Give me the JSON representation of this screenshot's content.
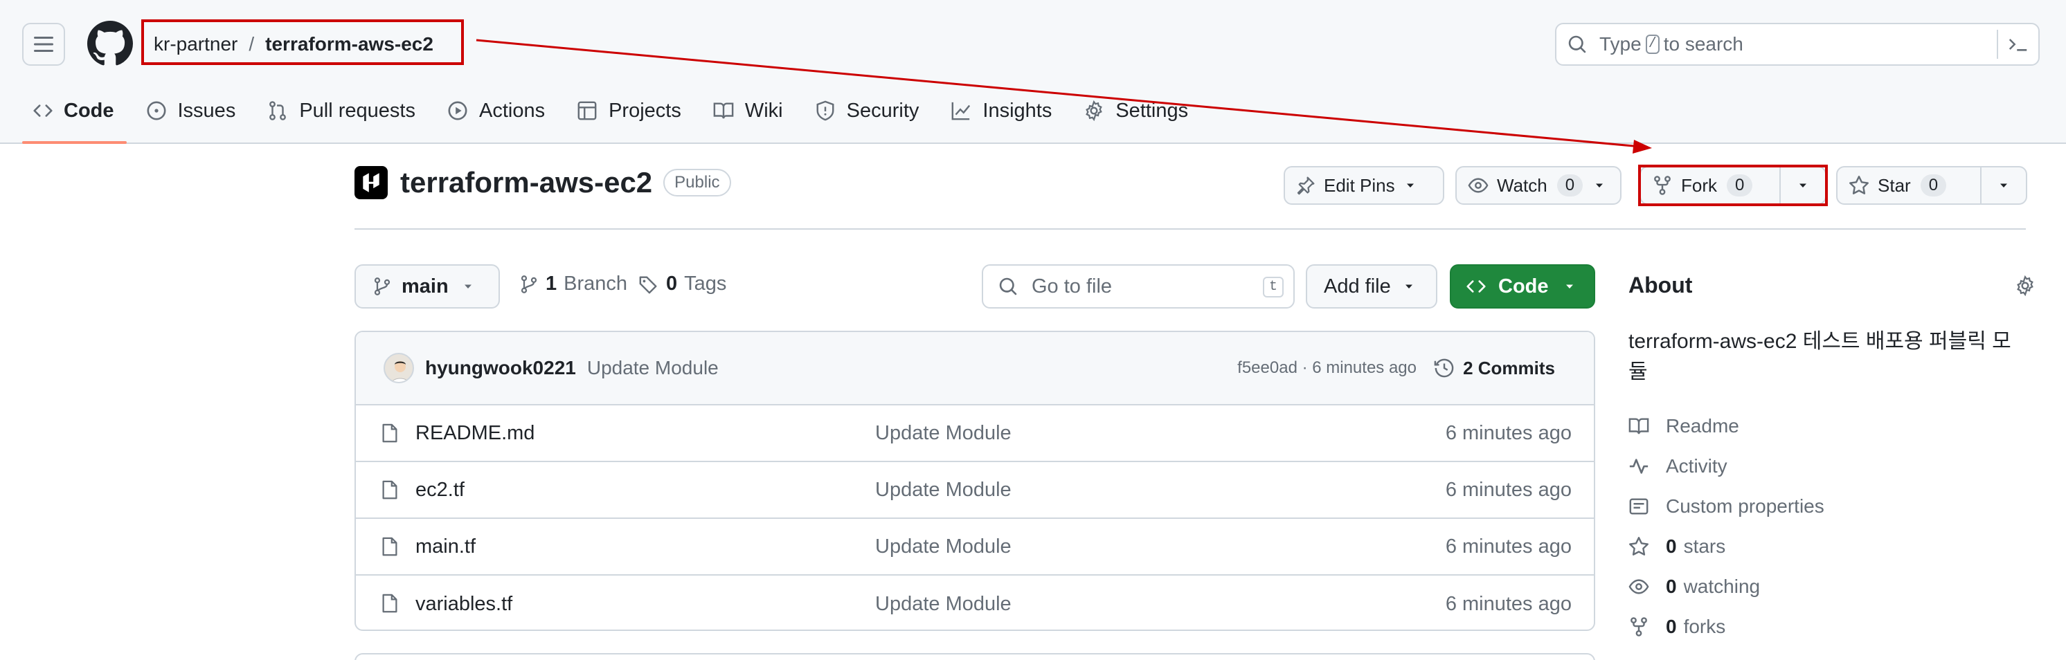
{
  "colors": {
    "accent_underline": "#fd8c73",
    "primary_green": "#1f883d",
    "annotation_red": "#cc0000",
    "muted_text": "#656d76"
  },
  "header": {
    "owner": "kr-partner",
    "separator": "/",
    "repo": "terraform-aws-ec2",
    "search": {
      "prefix": "Type",
      "key": "/",
      "suffix": "to search"
    }
  },
  "tabs": [
    {
      "label": "Code",
      "icon": "code-icon",
      "active": true
    },
    {
      "label": "Issues",
      "icon": "issue-icon"
    },
    {
      "label": "Pull requests",
      "icon": "pull-request-icon"
    },
    {
      "label": "Actions",
      "icon": "play-icon"
    },
    {
      "label": "Projects",
      "icon": "table-icon"
    },
    {
      "label": "Wiki",
      "icon": "book-icon"
    },
    {
      "label": "Security",
      "icon": "shield-icon"
    },
    {
      "label": "Insights",
      "icon": "graph-icon"
    },
    {
      "label": "Settings",
      "icon": "gear-icon"
    }
  ],
  "repo": {
    "title": "terraform-aws-ec2",
    "visibility": "Public",
    "edit_pins": "Edit Pins",
    "watch": {
      "label": "Watch",
      "count": "0"
    },
    "fork": {
      "label": "Fork",
      "count": "0"
    },
    "star": {
      "label": "Star",
      "count": "0"
    }
  },
  "filenav": {
    "branch": "main",
    "branches_count": "1",
    "branches_label": "Branch",
    "tags_count": "0",
    "tags_label": "Tags",
    "goto_placeholder": "Go to file",
    "goto_key": "t",
    "add_file": "Add file",
    "code": "Code"
  },
  "latest_commit": {
    "user": "hyungwook0221",
    "message": "Update Module",
    "meta": "f5ee0ad · 6 minutes ago",
    "commits_label": "2 Commits"
  },
  "files": [
    {
      "name": "README.md",
      "message": "Update Module",
      "time": "6 minutes ago"
    },
    {
      "name": "ec2.tf",
      "message": "Update Module",
      "time": "6 minutes ago"
    },
    {
      "name": "main.tf",
      "message": "Update Module",
      "time": "6 minutes ago"
    },
    {
      "name": "variables.tf",
      "message": "Update Module",
      "time": "6 minutes ago"
    }
  ],
  "about": {
    "title": "About",
    "description": "terraform-aws-ec2 테스트 배포용 퍼블릭 모듈",
    "readme": "Readme",
    "activity": "Activity",
    "custom_properties": "Custom properties",
    "stars_count": "0",
    "stars_label": "stars",
    "watching_count": "0",
    "watching_label": "watching",
    "forks_count": "0",
    "forks_label": "forks"
  }
}
